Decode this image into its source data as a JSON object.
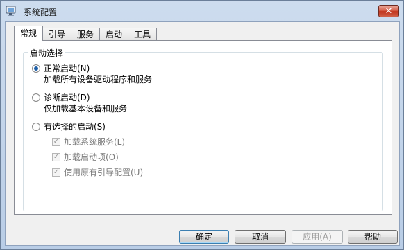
{
  "window": {
    "title": "系统配置",
    "close_label": "✕"
  },
  "tabs": [
    {
      "label": "常规",
      "active": true
    },
    {
      "label": "引导",
      "active": false
    },
    {
      "label": "服务",
      "active": false
    },
    {
      "label": "启动",
      "active": false
    },
    {
      "label": "工具",
      "active": false
    }
  ],
  "startup": {
    "legend": "启动选择",
    "normal": {
      "label": "正常启动(N)",
      "desc": "加载所有设备驱动程序和服务",
      "checked": true
    },
    "diagnostic": {
      "label": "诊断启动(D)",
      "desc": "仅加载基本设备和服务",
      "checked": false
    },
    "selective": {
      "label": "有选择的启动(S)",
      "checked": false
    },
    "options": [
      {
        "label": "加载系统服务(L)",
        "checked": true,
        "enabled": false
      },
      {
        "label": "加载启动项(O)",
        "checked": true,
        "enabled": false
      },
      {
        "label": "使用原有引导配置(U)",
        "checked": true,
        "enabled": false
      }
    ]
  },
  "buttons": {
    "ok": "确定",
    "cancel": "取消",
    "apply": "应用(A)",
    "help": "帮助"
  }
}
